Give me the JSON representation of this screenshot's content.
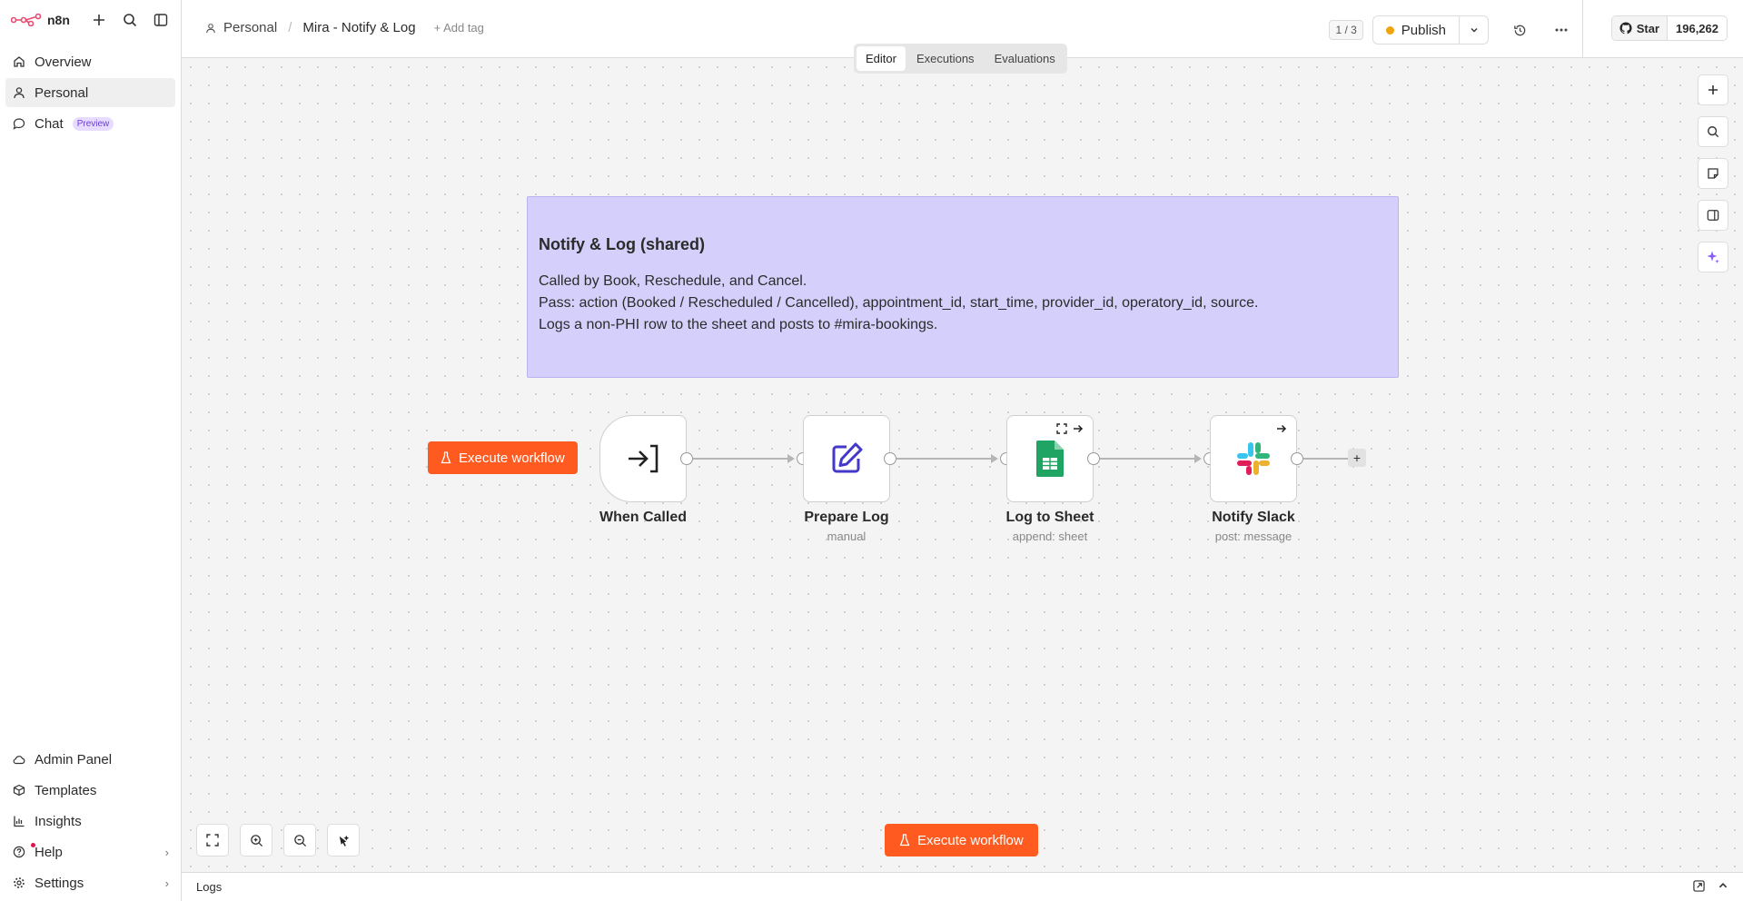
{
  "sidebar": {
    "brand": "n8n",
    "nav": [
      {
        "label": "Overview",
        "icon": "home-icon"
      },
      {
        "label": "Personal",
        "icon": "user-icon"
      },
      {
        "label": "Chat",
        "icon": "chat-icon",
        "badge": "Preview"
      }
    ],
    "bottom": [
      {
        "label": "Admin Panel",
        "icon": "cloud-icon"
      },
      {
        "label": "Templates",
        "icon": "box-icon"
      },
      {
        "label": "Insights",
        "icon": "chart-icon"
      },
      {
        "label": "Help",
        "icon": "help-icon"
      },
      {
        "label": "Settings",
        "icon": "gear-icon"
      }
    ]
  },
  "header": {
    "project": "Personal",
    "workflow_name": "Mira - Notify & Log",
    "add_tag": "+ Add tag",
    "version_count": "1 / 3",
    "publish_label": "Publish",
    "github_star": "Star",
    "github_count": "196,262"
  },
  "tabs": [
    "Editor",
    "Executions",
    "Evaluations"
  ],
  "note": {
    "title": "Notify & Log (shared)",
    "lines": [
      "Called by Book, Reschedule, and Cancel.",
      "Pass: action (Booked / Rescheduled / Cancelled), appointment_id, start_time, provider_id, operatory_id, source.",
      "Logs a non-PHI row to the sheet and posts to #mira-bookings."
    ]
  },
  "execute_label": "Execute workflow",
  "nodes": [
    {
      "label": "When Called",
      "subtitle": ""
    },
    {
      "label": "Prepare Log",
      "subtitle": "manual"
    },
    {
      "label": "Log to Sheet",
      "subtitle": "append: sheet"
    },
    {
      "label": "Notify Slack",
      "subtitle": "post: message"
    }
  ],
  "logs_label": "Logs",
  "colors": {
    "accent": "#ff5a1f",
    "note_bg": "#d5d0fb",
    "brand": "#ea4b71"
  }
}
